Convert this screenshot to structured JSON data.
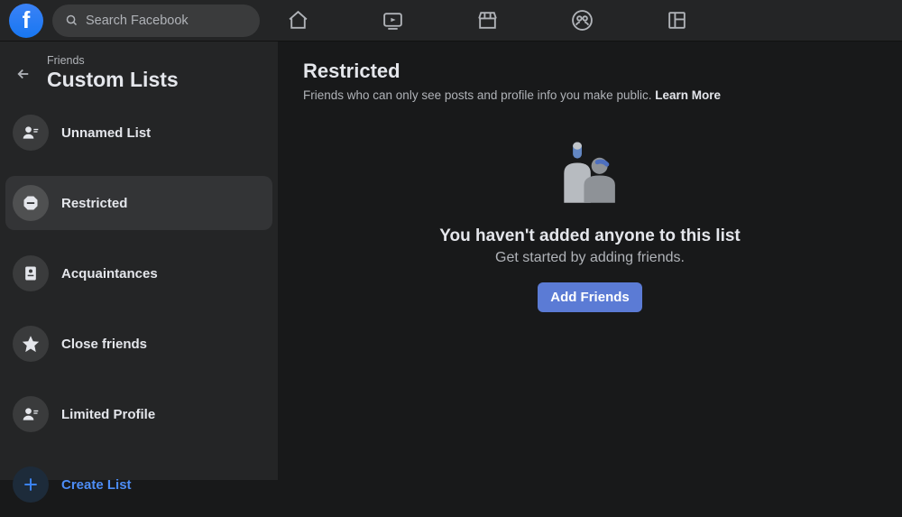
{
  "search": {
    "placeholder": "Search Facebook"
  },
  "sidebar": {
    "breadcrumb": "Friends",
    "title": "Custom Lists",
    "items": [
      {
        "label": "Unnamed List",
        "icon": "person"
      },
      {
        "label": "Restricted",
        "icon": "stop"
      },
      {
        "label": "Acquaintances",
        "icon": "badge"
      },
      {
        "label": "Close friends",
        "icon": "star"
      },
      {
        "label": "Limited Profile",
        "icon": "person"
      }
    ],
    "create_label": "Create List"
  },
  "main": {
    "title": "Restricted",
    "subtitle": "Friends who can only see posts and profile info you make public.",
    "learn_more": "Learn More",
    "empty_title": "You haven't added anyone to this list",
    "empty_sub": "Get started by adding friends.",
    "add_button": "Add Friends"
  },
  "colors": {
    "accent": "#4d8df6",
    "button": "#5b7bd5"
  }
}
